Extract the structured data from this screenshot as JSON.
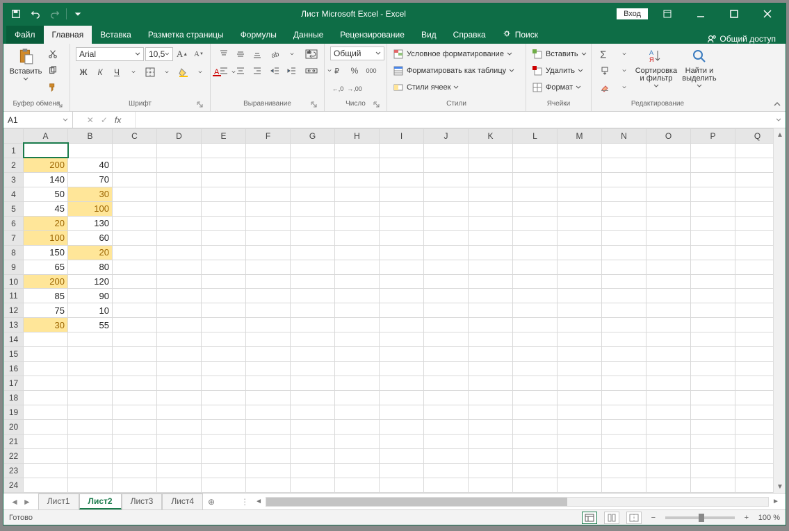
{
  "title": "Лист Microsoft Excel  -  Excel",
  "login_label": "Вход",
  "tabs": {
    "file": "Файл",
    "home": "Главная",
    "insert": "Вставка",
    "layout": "Разметка страницы",
    "formulas": "Формулы",
    "data": "Данные",
    "review": "Рецензирование",
    "view": "Вид",
    "help": "Справка",
    "search": "Поиск",
    "share": "Общий доступ"
  },
  "ribbon": {
    "clipboard": {
      "paste": "Вставить",
      "label": "Буфер обмена"
    },
    "font": {
      "name": "Arial",
      "size": "10,5",
      "bold": "Ж",
      "italic": "К",
      "underline": "Ч",
      "label": "Шрифт"
    },
    "alignment": {
      "label": "Выравнивание"
    },
    "number": {
      "format": "Общий",
      "label": "Число"
    },
    "styles": {
      "cond": "Условное форматирование",
      "table": "Форматировать как таблицу",
      "cell": "Стили ячеек",
      "label": "Стили"
    },
    "cells": {
      "insert": "Вставить",
      "delete": "Удалить",
      "format": "Формат",
      "label": "Ячейки"
    },
    "editing": {
      "sort": "Сортировка и фильтр",
      "find": "Найти и выделить",
      "label": "Редактирование"
    }
  },
  "namebox": "A1",
  "columns": [
    "A",
    "B",
    "C",
    "D",
    "E",
    "F",
    "G",
    "H",
    "I",
    "J",
    "K",
    "L",
    "M",
    "N",
    "O",
    "P",
    "Q"
  ],
  "rows_count": 24,
  "cells": {
    "A2": {
      "v": "200",
      "hl": true
    },
    "B2": {
      "v": "40"
    },
    "A3": {
      "v": "140"
    },
    "B3": {
      "v": "70"
    },
    "A4": {
      "v": "50"
    },
    "B4": {
      "v": "30",
      "hl": true
    },
    "A5": {
      "v": "45"
    },
    "B5": {
      "v": "100",
      "hl": true
    },
    "A6": {
      "v": "20",
      "hl": true
    },
    "B6": {
      "v": "130"
    },
    "A7": {
      "v": "100",
      "hl": true
    },
    "B7": {
      "v": "60"
    },
    "A8": {
      "v": "150"
    },
    "B8": {
      "v": "20",
      "hl": true
    },
    "A9": {
      "v": "65"
    },
    "B9": {
      "v": "80"
    },
    "A10": {
      "v": "200",
      "hl": true
    },
    "B10": {
      "v": "120"
    },
    "A11": {
      "v": "85"
    },
    "B11": {
      "v": "90"
    },
    "A12": {
      "v": "75"
    },
    "B12": {
      "v": "10"
    },
    "A13": {
      "v": "30",
      "hl": true
    },
    "B13": {
      "v": "55"
    }
  },
  "selected_cell": "A1",
  "sheets": [
    "Лист1",
    "Лист2",
    "Лист3",
    "Лист4"
  ],
  "active_sheet": 1,
  "status": "Готово",
  "zoom": "100 %",
  "number_symbols": {
    "percent": "%",
    "thousands": "000",
    "inc": ",0",
    "dec": ",00"
  }
}
